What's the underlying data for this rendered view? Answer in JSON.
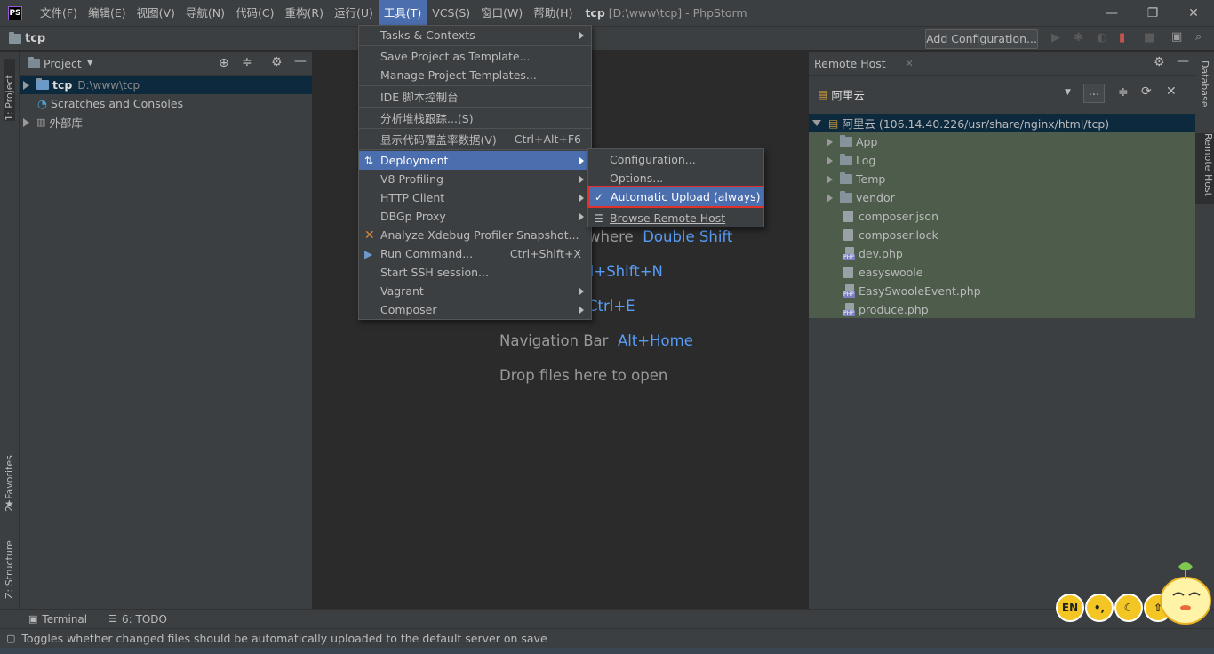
{
  "app": {
    "logo": "PS",
    "title_project": "tcp",
    "title_rest": "[D:\\www\\tcp] - PhpStorm"
  },
  "menu": [
    "文件(F)",
    "编辑(E)",
    "视图(V)",
    "导航(N)",
    "代码(C)",
    "重构(R)",
    "运行(U)",
    "工具(T)",
    "VCS(S)",
    "窗口(W)",
    "帮助(H)"
  ],
  "navbar": {
    "breadcrumb": "tcp",
    "add_config": "Add Configuration..."
  },
  "left_tabs": {
    "project": "1: Project",
    "favorites": "2: Favorites",
    "structure": "Z: Structure"
  },
  "right_tabs": {
    "database": "Database",
    "remote_host": "Remote Host"
  },
  "project": {
    "header": "Project",
    "root_name": "tcp",
    "root_path": "D:\\www\\tcp",
    "scratches": "Scratches and Consoles",
    "external": "外部库"
  },
  "editor_hints": [
    {
      "text": "where",
      "key": "Double Shift"
    },
    {
      "text": "",
      "key": "rl+Shift+N"
    },
    {
      "text": "",
      "key": "Ctrl+E"
    },
    {
      "text": "Navigation Bar",
      "key": "Alt+Home"
    },
    {
      "text": "Drop files here to open",
      "key": ""
    }
  ],
  "remote": {
    "title": "Remote Host",
    "server": "阿里云",
    "root": "阿里云 (106.14.40.226/usr/share/nginx/html/tcp)",
    "items": [
      "App",
      "Log",
      "Temp",
      "vendor",
      "composer.json",
      "composer.lock",
      "dev.php",
      "easyswoole",
      "EasySwooleEvent.php",
      "produce.php"
    ],
    "more_button": "..."
  },
  "tools_menu": {
    "items": [
      {
        "label": "Tasks & Contexts",
        "shortcut": ""
      },
      {
        "label": "Save Project as Template...",
        "shortcut": ""
      },
      {
        "label": "Manage Project Templates...",
        "shortcut": ""
      },
      {
        "label": "IDE 脚本控制台",
        "shortcut": ""
      },
      {
        "label": "分析堆栈跟踪...(S)",
        "shortcut": ""
      },
      {
        "label": "显示代码覆盖率数据(V)",
        "shortcut": "Ctrl+Alt+F6"
      },
      {
        "label": "Deployment",
        "shortcut": ""
      },
      {
        "label": "V8 Profiling",
        "shortcut": ""
      },
      {
        "label": "HTTP Client",
        "shortcut": ""
      },
      {
        "label": "DBGp Proxy",
        "shortcut": ""
      },
      {
        "label": "Analyze Xdebug Profiler Snapshot...",
        "shortcut": ""
      },
      {
        "label": "Run Command...",
        "shortcut": "Ctrl+Shift+X"
      },
      {
        "label": "Start SSH session...",
        "shortcut": ""
      },
      {
        "label": "Vagrant",
        "shortcut": ""
      },
      {
        "label": "Composer",
        "shortcut": ""
      }
    ]
  },
  "deploy_menu": {
    "items": [
      "Configuration...",
      "Options...",
      "Automatic Upload (always)",
      "Browse Remote Host"
    ]
  },
  "bottom": {
    "terminal": "Terminal",
    "todo": "6: TODO"
  },
  "status": "Toggles whether changed files should be automatically uploaded to the default server on save",
  "ime": {
    "en": "EN"
  },
  "colors": {
    "accent": "#4b6eaf",
    "highlight_border": "#e0302a",
    "link": "#589df6"
  }
}
